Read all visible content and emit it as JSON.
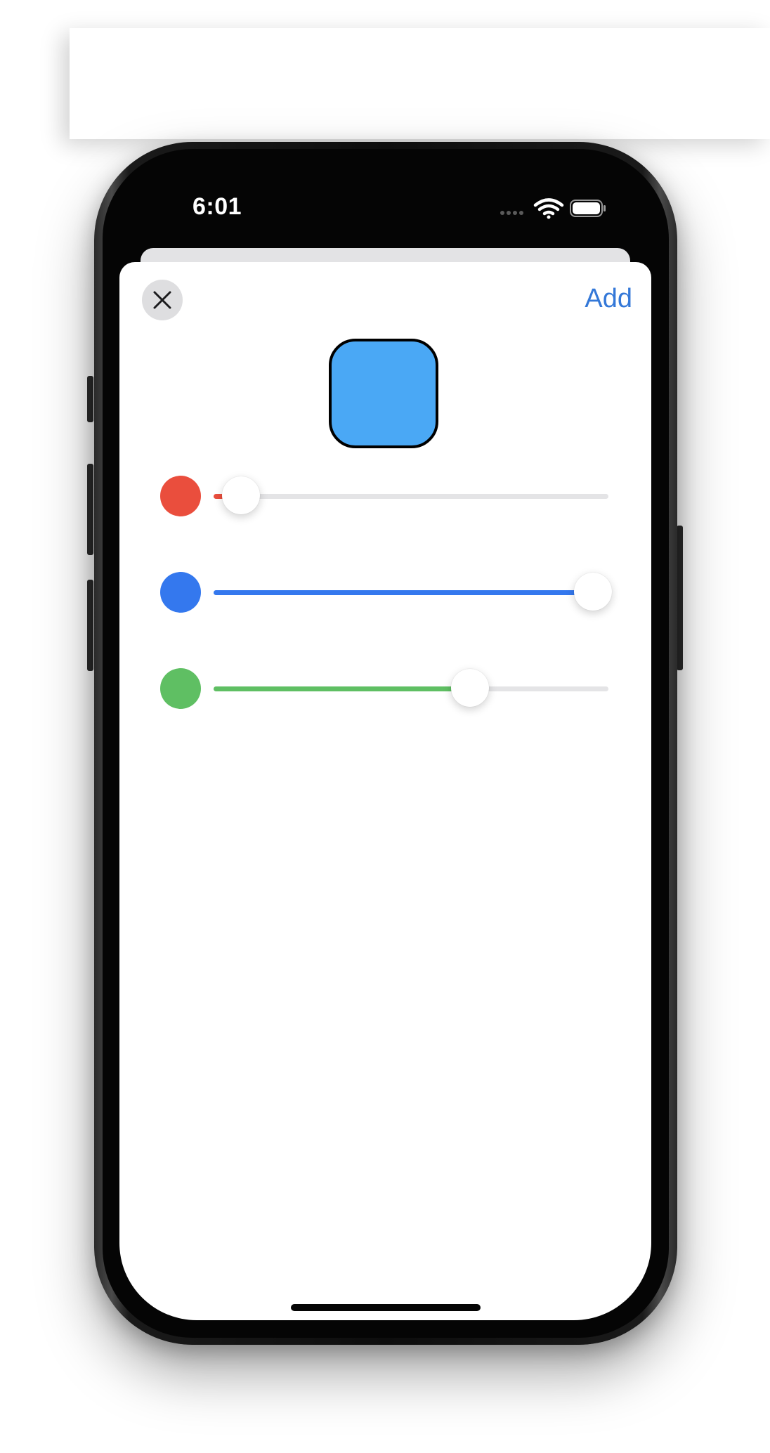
{
  "status_bar": {
    "time": "6:01",
    "icons": [
      "cellular-dots-icon",
      "wifi-icon",
      "battery-icon"
    ]
  },
  "sheet": {
    "close_icon": "close-icon",
    "add_label": "Add",
    "accent_color": "#3478d8",
    "preview_color": "#4aa8f5"
  },
  "sliders": [
    {
      "channel": "red",
      "color": "#ea4e3d",
      "value": 0.07
    },
    {
      "channel": "blue",
      "color": "#3478ee",
      "value": 0.96
    },
    {
      "channel": "green",
      "color": "#5fbf63",
      "value": 0.65
    }
  ]
}
